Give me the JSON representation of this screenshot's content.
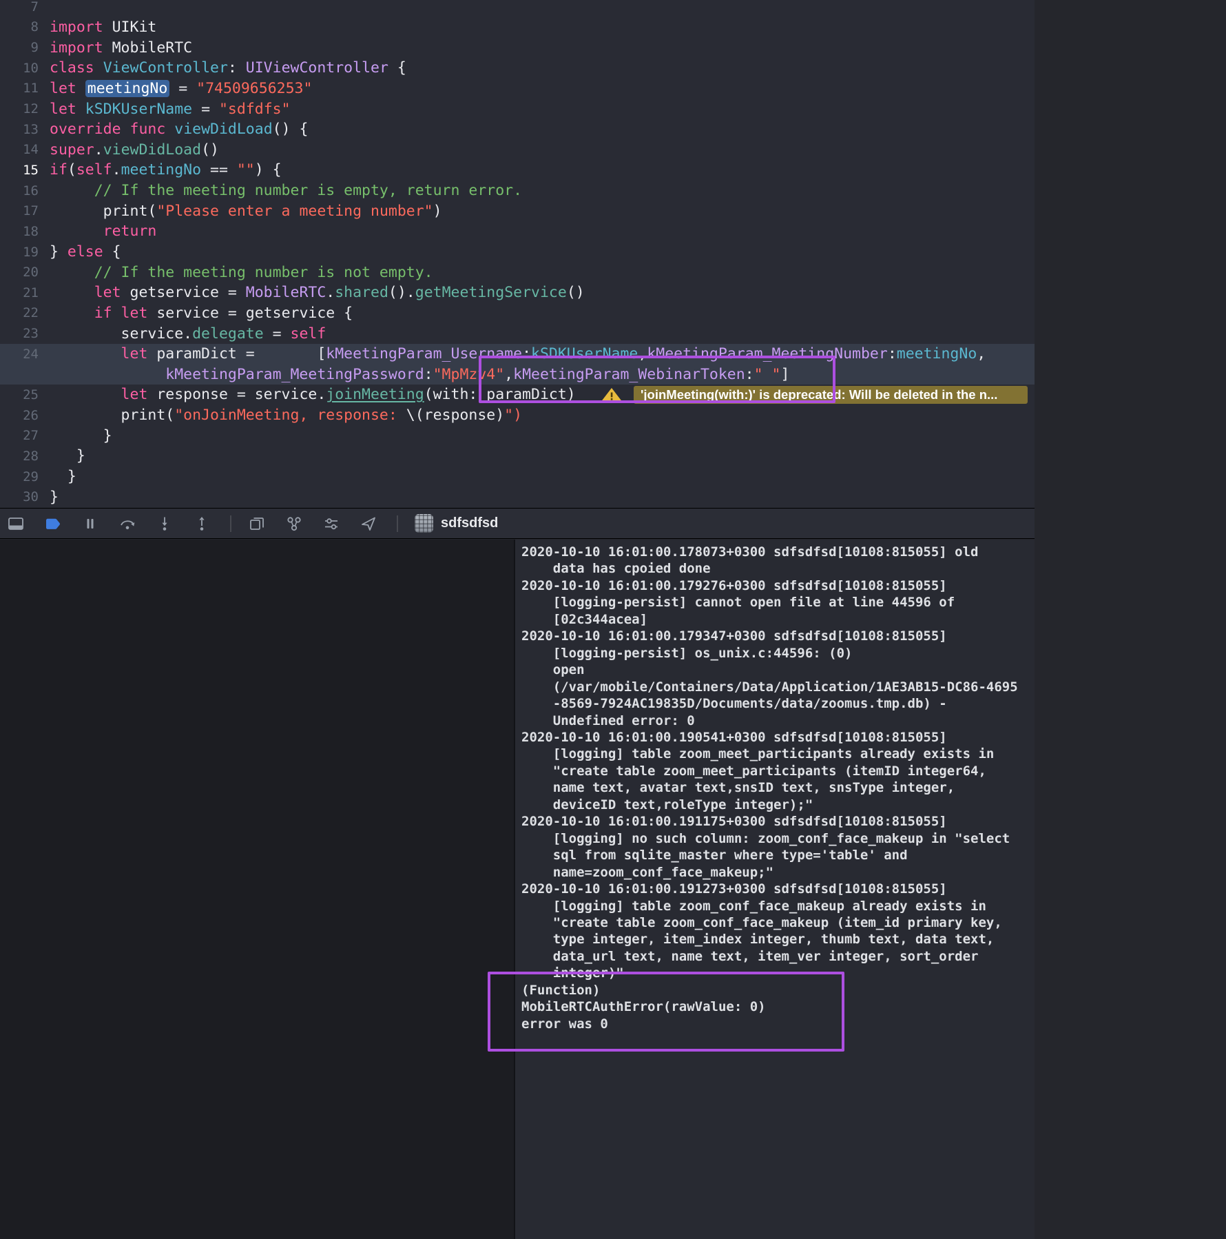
{
  "window": {
    "process_name": "sdfsdfsd"
  },
  "editor": {
    "rows": [
      {
        "n": "7",
        "t": []
      },
      {
        "n": "8",
        "t": [
          [
            "k",
            "import"
          ],
          [
            "w",
            " UIKit"
          ]
        ]
      },
      {
        "n": "9",
        "t": [
          [
            "k",
            "import"
          ],
          [
            "w",
            " MobileRTC"
          ]
        ]
      },
      {
        "n": "10",
        "t": [
          [
            "k",
            "class"
          ],
          [
            "w",
            " "
          ],
          [
            "d",
            "ViewController"
          ],
          [
            "w",
            ": "
          ],
          [
            "u",
            "UIViewController"
          ],
          [
            "w",
            " {"
          ]
        ]
      },
      {
        "n": "11",
        "t": [
          [
            "k",
            "let"
          ],
          [
            "w",
            " "
          ],
          [
            "hl-tok",
            "meetingNo"
          ],
          [
            "w",
            " = "
          ],
          [
            "s",
            "\"74509656253\""
          ]
        ]
      },
      {
        "n": "12",
        "t": [
          [
            "k",
            "let"
          ],
          [
            "w",
            " "
          ],
          [
            "d",
            "kSDKUserName"
          ],
          [
            "w",
            " = "
          ],
          [
            "s",
            "\"sdfdfs\""
          ]
        ]
      },
      {
        "n": "13",
        "t": [
          [
            "k",
            "override"
          ],
          [
            "w",
            " "
          ],
          [
            "k",
            "func"
          ],
          [
            "w",
            " "
          ],
          [
            "d",
            "viewDidLoad"
          ],
          [
            "w",
            "() {"
          ]
        ]
      },
      {
        "n": "14",
        "t": [
          [
            "k",
            "super"
          ],
          [
            "w",
            "."
          ],
          [
            "m",
            "viewDidLoad"
          ],
          [
            "w",
            "()"
          ]
        ]
      },
      {
        "n": "15",
        "bp": true,
        "t": [
          [
            "k",
            "if"
          ],
          [
            "w",
            "("
          ],
          [
            "k",
            "self"
          ],
          [
            "w",
            "."
          ],
          [
            "d",
            "meetingNo"
          ],
          [
            "w",
            " == "
          ],
          [
            "s",
            "\"\""
          ],
          [
            "w",
            ") {"
          ]
        ]
      },
      {
        "n": "16",
        "t": [
          [
            "c",
            "     // If the meeting number is empty, return error."
          ]
        ]
      },
      {
        "n": "17",
        "t": [
          [
            "w",
            "      print("
          ],
          [
            "s",
            "\"Please enter a meeting number\""
          ],
          [
            "w",
            ")"
          ]
        ]
      },
      {
        "n": "18",
        "t": [
          [
            "k",
            "      return"
          ]
        ]
      },
      {
        "n": "19",
        "t": [
          [
            "w",
            "} "
          ],
          [
            "k",
            "else"
          ],
          [
            "w",
            " {"
          ]
        ]
      },
      {
        "n": "20",
        "t": [
          [
            "c",
            "     // If the meeting number is not empty."
          ]
        ]
      },
      {
        "n": "21",
        "t": [
          [
            "k",
            "     let"
          ],
          [
            "w",
            " getservice = "
          ],
          [
            "u",
            "MobileRTC"
          ],
          [
            "w",
            "."
          ],
          [
            "m",
            "shared"
          ],
          [
            "w",
            "()."
          ],
          [
            "m",
            "getMeetingService"
          ],
          [
            "w",
            "()"
          ]
        ]
      },
      {
        "n": "22",
        "t": [
          [
            "k",
            "     if"
          ],
          [
            "w",
            " "
          ],
          [
            "k",
            "let"
          ],
          [
            "w",
            " service = getservice {"
          ]
        ]
      },
      {
        "n": "23",
        "t": [
          [
            "w",
            "        service."
          ],
          [
            "m",
            "delegate"
          ],
          [
            "w",
            " = "
          ],
          [
            "k",
            "self"
          ]
        ]
      },
      {
        "n": "24",
        "hl": true,
        "t": [
          [
            "k",
            "        let"
          ],
          [
            "w",
            " paramDict =       ["
          ],
          [
            "u",
            "kMeetingParam_Username"
          ],
          [
            "w",
            ":"
          ],
          [
            "d",
            "kSDKUserName"
          ],
          [
            "w",
            ","
          ],
          [
            "u",
            "kMeetingParam_MeetingNumber"
          ],
          [
            "w",
            ":"
          ],
          [
            "d",
            "meetingNo"
          ],
          [
            "w",
            ","
          ]
        ]
      },
      {
        "n": null,
        "hl": true,
        "t": [
          [
            "u",
            "             kMeetingParam_MeetingPassword"
          ],
          [
            "w",
            ":"
          ],
          [
            "s",
            "\"MpMzv4\""
          ],
          [
            "w",
            ","
          ],
          [
            "u",
            "kMeetingParam_WebinarToken"
          ],
          [
            "w",
            ":"
          ],
          [
            "s",
            "\" \""
          ],
          [
            "w",
            "]"
          ]
        ]
      },
      {
        "n": "25",
        "warn": true,
        "t": [
          [
            "k",
            "        let"
          ],
          [
            "w",
            " response = service."
          ],
          [
            "m ul",
            "joinMeeting"
          ],
          [
            "w",
            "(with: paramDict)"
          ]
        ]
      },
      {
        "n": "26",
        "t": [
          [
            "w",
            "        print("
          ],
          [
            "s",
            "\"onJoinMeeting, response: "
          ],
          [
            "w",
            "\\(response)"
          ],
          [
            "s",
            "\")"
          ]
        ]
      },
      {
        "n": "27",
        "t": [
          [
            "w",
            "      }"
          ]
        ]
      },
      {
        "n": "28",
        "t": [
          [
            "w",
            "   }"
          ]
        ]
      },
      {
        "n": "29",
        "t": [
          [
            "w",
            "  }"
          ]
        ]
      },
      {
        "n": "30",
        "t": [
          [
            "w",
            "}"
          ]
        ]
      }
    ]
  },
  "warning": {
    "label": "'joinMeeting(with:)' is deprecated: Will be deleted in the n..."
  },
  "toolbar": {
    "process_name": "sdfsdfsd",
    "buttons": [
      "hide-debug-area",
      "breakpoints-toggle",
      "pause-execution",
      "step-over",
      "step-into",
      "step-out",
      "debug-view-hierarchy",
      "memory-graph",
      "environment-overrides",
      "simulate-location"
    ]
  },
  "console": {
    "lines": [
      "2020-10-10 16:01:00.178073+0300 sdfsdfsd[10108:815055] old",
      "    data has cpoied done",
      "2020-10-10 16:01:00.179276+0300 sdfsdfsd[10108:815055]",
      "    [logging-persist] cannot open file at line 44596 of",
      "    [02c344acea]",
      "2020-10-10 16:01:00.179347+0300 sdfsdfsd[10108:815055]",
      "    [logging-persist] os_unix.c:44596: (0)",
      "    open",
      "    (/var/mobile/Containers/Data/Application/1AE3AB15-DC86-4695",
      "    -8569-7924AC19835D/Documents/data/zoomus.tmp.db) -",
      "    Undefined error: 0",
      "2020-10-10 16:01:00.190541+0300 sdfsdfsd[10108:815055]",
      "    [logging] table zoom_meet_participants already exists in",
      "    \"create table zoom_meet_participants (itemID integer64,",
      "    name text, avatar text,snsID text, snsType integer,",
      "    deviceID text,roleType integer);\"",
      "2020-10-10 16:01:00.191175+0300 sdfsdfsd[10108:815055]",
      "    [logging] no such column: zoom_conf_face_makeup in \"select",
      "    sql from sqlite_master where type='table' and",
      "    name=zoom_conf_face_makeup;\"",
      "2020-10-10 16:01:00.191273+0300 sdfsdfsd[10108:815055]",
      "    [logging] table zoom_conf_face_makeup already exists in",
      "    \"create table zoom_conf_face_makeup (item_id primary key,",
      "    type integer, item_index integer, thumb text, data text,",
      "    data_url text, name text, item_ver integer, sort_order",
      "    integer)\"",
      "(Function)",
      "MobileRTCAuthError(rawValue: 0)",
      "error was 0"
    ]
  },
  "annotations": {
    "color": "#ad4fe0",
    "boxes": [
      "code-paramdict-join-meeting",
      "console-auth-error-result"
    ]
  }
}
